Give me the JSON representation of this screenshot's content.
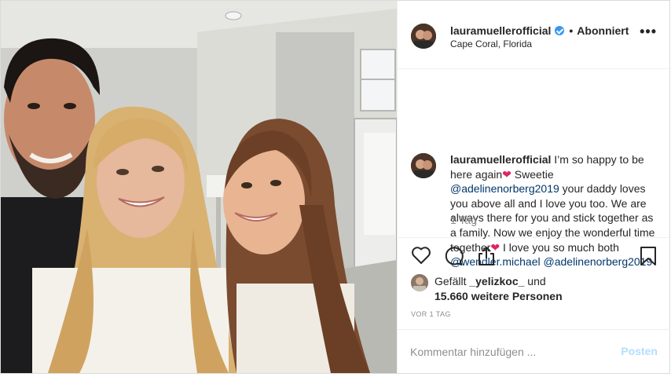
{
  "post": {
    "username": "lauramuellerofficial",
    "follow_state": "Abonniert",
    "separator": "•",
    "location": "Cape Coral, Florida",
    "more_label": "•••"
  },
  "caption": {
    "username": "lauramuellerofficial",
    "part1": " I’m so happy to be here again",
    "heart1": "❤",
    "part2": " Sweetie ",
    "mention1": "@adelinenorberg2019",
    "part3": " your daddy loves you above all and I love you too. We are always there for you and stick together as a family. Now we enjoy the wonderful time together",
    "heart2": "❤",
    "part4": " I love you so much both ",
    "mention2": "@wendler.michael",
    "space": " ",
    "mention3": "@adelinenorberg2019",
    "time": "1 Tag"
  },
  "actions": {
    "like_icon": "heart-outline-icon",
    "comment_icon": "comment-icon",
    "share_icon": "share-icon",
    "save_icon": "bookmark-icon"
  },
  "likes": {
    "prefix": "Gefällt ",
    "user": "_yelizkoc_",
    "suffix": " und",
    "count_text": "15.660 weitere Personen"
  },
  "ago": "VOR 1 TAG",
  "comment": {
    "placeholder": "Kommentar hinzufügen ...",
    "post_label": "Posten"
  },
  "colors": {
    "verified": "#3897f0",
    "mention": "#00376b",
    "heart": "#e0245e",
    "post_button_disabled": "#b2dffc"
  }
}
